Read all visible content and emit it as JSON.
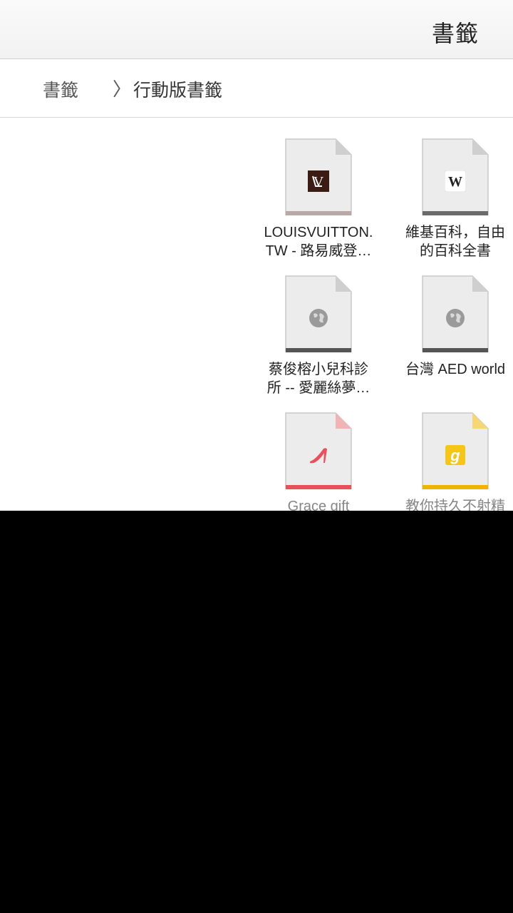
{
  "navbar": {
    "title": "書籤"
  },
  "breadcrumb": {
    "root": "書籤",
    "separator": "〉",
    "current": "行動版書籤"
  },
  "bookmarks": [
    {
      "label": "LOUISVUITTON.\nTW - 路易威登…",
      "icon": "lv-logo-icon",
      "accent": "#b8a9a6"
    },
    {
      "label": "維基百科，自由\n的百科全書",
      "icon": "wikipedia-w-icon",
      "accent": "#6b6b6b"
    },
    {
      "label": "蔡俊榕小兒科診\n所 -- 愛麗絲夢…",
      "icon": "globe-icon",
      "accent": "#555555"
    },
    {
      "label": "台灣 AED world",
      "icon": "globe-icon",
      "accent": "#555555"
    },
    {
      "label": "Grace gift",
      "icon": "high-heel-icon",
      "accent": "#e8505b"
    },
    {
      "label": "教你持久不射精",
      "icon": "g-logo-icon",
      "accent": "#f0b400"
    }
  ]
}
